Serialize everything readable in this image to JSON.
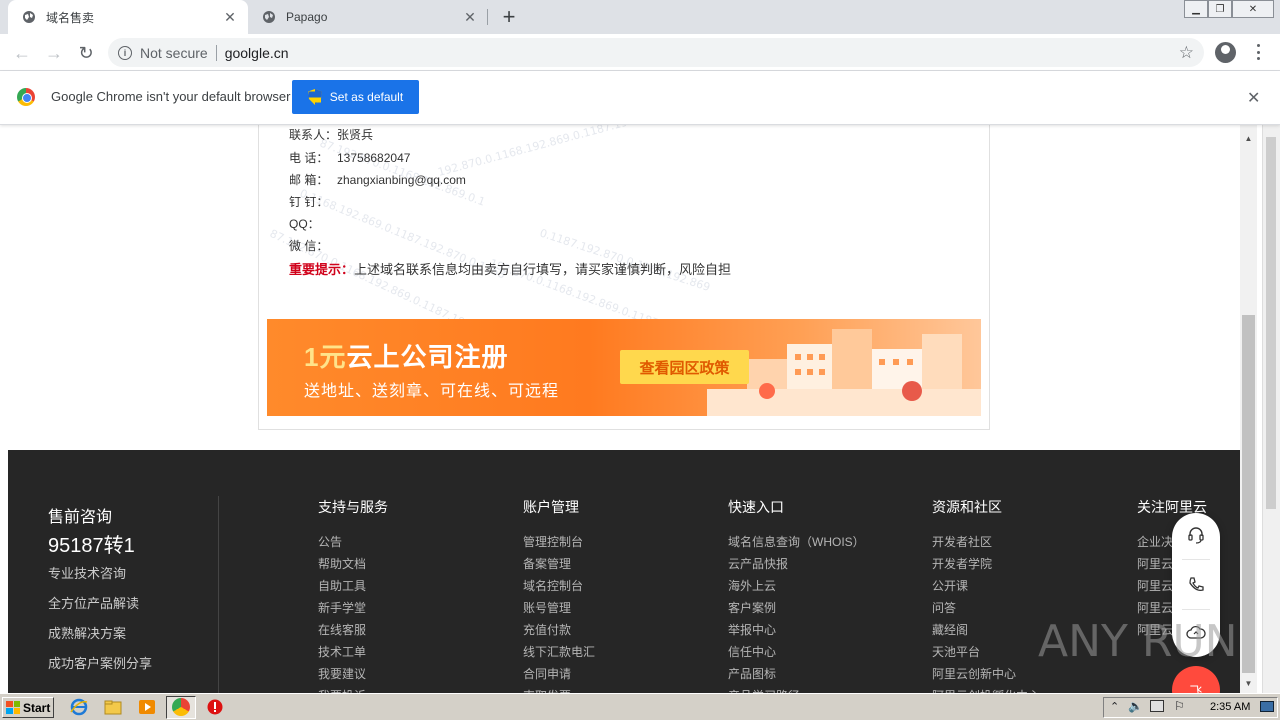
{
  "browser": {
    "tabs": [
      {
        "title": "域名售卖",
        "active": true
      },
      {
        "title": "Papago",
        "active": false
      }
    ],
    "address": {
      "security_label": "Not secure",
      "url": "goolgle.cn"
    },
    "infobar": {
      "message": "Google Chrome isn't your default browser",
      "button": "Set as default"
    }
  },
  "contact": {
    "rows": [
      {
        "label": "联系人：",
        "value": "张贤兵"
      },
      {
        "label": "电 话：",
        "value": "13758682047"
      },
      {
        "label": "邮 箱：",
        "value": "zhangxianbing@qq.com"
      },
      {
        "label": "钉 钉：",
        "value": ""
      },
      {
        "label": "QQ：",
        "value": ""
      },
      {
        "label": "微 信：",
        "value": ""
      }
    ],
    "notice_label": "重要提示：",
    "notice_text": "上述域名联系信息均由卖方自行填写，请买家谨慎判断，风险自担"
  },
  "banner": {
    "title_highlight": "1元",
    "title_rest": "云上公司注册",
    "subtitle": "送地址、送刻章、可在线、可远程",
    "button": "查看园区政策"
  },
  "footer": {
    "hotline_title": "售前咨询",
    "hotline_number": "95187转1",
    "left_items": [
      "专业技术咨询",
      "全方位产品解读",
      "成熟解决方案",
      "成功客户案例分享"
    ],
    "columns": [
      {
        "title": "支持与服务",
        "items": [
          "公告",
          "帮助文档",
          "自助工具",
          "新手学堂",
          "在线客服",
          "技术工单",
          "我要建议",
          "我要投诉"
        ]
      },
      {
        "title": "账户管理",
        "items": [
          "管理控制台",
          "备案管理",
          "域名控制台",
          "账号管理",
          "充值付款",
          "线下汇款电汇",
          "合同申请",
          "索取发票"
        ]
      },
      {
        "title": "快速入口",
        "items": [
          "域名信息查询（WHOIS）",
          "云产品快报",
          "海外上云",
          "客户案例",
          "举报中心",
          "信任中心",
          "产品图标",
          "产品学习路径"
        ]
      },
      {
        "title": "资源和社区",
        "items": [
          "开发者社区",
          "开发者学院",
          "公开课",
          "问答",
          "藏经阁",
          "天池平台",
          "阿里云创新中心",
          "阿里云创投孵化中心"
        ]
      },
      {
        "title": "关注阿里云",
        "items": [
          "企业决",
          "阿里云",
          "阿里云",
          "阿里云",
          "阿里云"
        ]
      }
    ],
    "float_button": "飞"
  },
  "watermark_text": "ANY RUN",
  "taskbar": {
    "start": "Start",
    "clock": "2:35 AM"
  }
}
